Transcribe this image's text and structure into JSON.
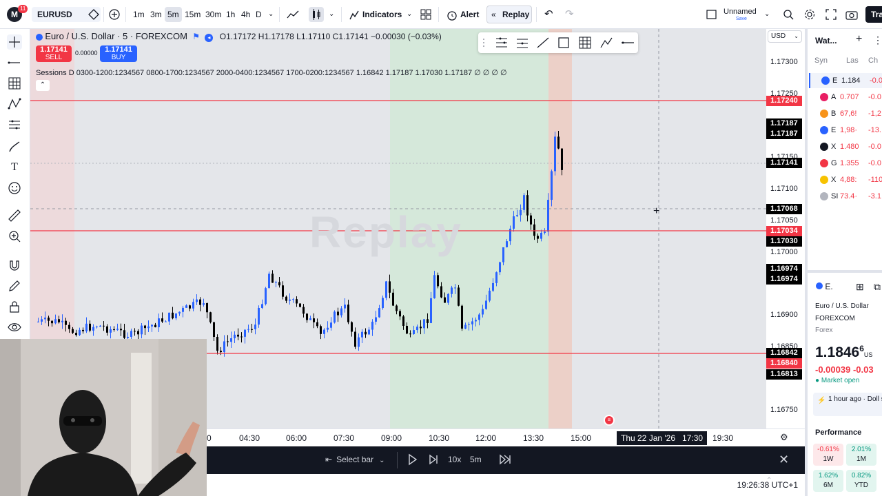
{
  "topbar": {
    "logo_letter": "M",
    "logo_badge": "11",
    "symbol": "EURUSD",
    "intervals": [
      "1m",
      "3m",
      "5m",
      "15m",
      "30m",
      "1h",
      "4h",
      "D"
    ],
    "active_interval": "5m",
    "indicators_label": "Indicators",
    "alert_label": "Alert",
    "replay_label": "Replay",
    "layout_name": "Unnamed",
    "layout_status": "Save",
    "trade_label": "Tra"
  },
  "legend": {
    "title": "Euro / U.S. Dollar · 5 · FOREXCOM",
    "ohlc": "O1.17172 H1.17178 L1.17110 C1.17141 −0.00030 (−0.03%)",
    "sell_price": "1.17141",
    "sell_label": "SELL",
    "buy_price": "1.17141",
    "buy_label": "BUY",
    "spread": "0.00000",
    "sessions": "Sessions D 0300-1200:1234567 0800-1700:1234567 2000-0400:1234567 1700-0200:1234567  1.16842  1.17187  1.17030  1.17187  ∅  ∅  ∅  ∅"
  },
  "watermark": "Replay",
  "currency": "USD",
  "price_ticks": [
    "1.17300",
    "1.17250",
    "1.17150",
    "1.17100",
    "1.17050",
    "1.17000",
    "1.16900",
    "1.16850",
    "1.16750"
  ],
  "price_labels": [
    {
      "text": "1.17240",
      "style": "red"
    },
    {
      "text": "1.17187",
      "style": "black"
    },
    {
      "text": "1.17187",
      "style": "black"
    },
    {
      "text": "1.17141",
      "style": "black"
    },
    {
      "text": "1.17068",
      "style": "black"
    },
    {
      "text": "1.17034",
      "style": "red"
    },
    {
      "text": "1.17030",
      "style": "black"
    },
    {
      "text": "1.16974",
      "style": "black"
    },
    {
      "text": "1.16974",
      "style": "black"
    },
    {
      "text": "1.16842",
      "style": "black"
    },
    {
      "text": "1.16840",
      "style": "red"
    },
    {
      "text": "1.16813",
      "style": "black"
    }
  ],
  "time_ticks": [
    "0",
    "04:30",
    "06:00",
    "07:30",
    "09:00",
    "10:30",
    "12:00",
    "13:30",
    "15:00",
    "19:30"
  ],
  "crosshair_time": "Thu 22 Jan '26   17:30",
  "replay": {
    "select_bar": "Select bar",
    "speed": "10x",
    "interval": "5m"
  },
  "status_time": "19:26:38 UTC+1",
  "watchlist": {
    "title": "Wat...",
    "columns": [
      "Syn",
      "Las",
      "Ch"
    ],
    "rows": [
      {
        "sym": "E",
        "last": "1.184",
        "chg": "-0.0",
        "chg_color": "neg"
      },
      {
        "sym": "A",
        "last": "0.707",
        "chg": "-0.0",
        "chg_color": "neg"
      },
      {
        "sym": "B",
        "last": "67,6!",
        "chg": "-1,2",
        "chg_color": "neg"
      },
      {
        "sym": "E",
        "last": "1,98·",
        "chg": "-13.",
        "chg_color": "neg"
      },
      {
        "sym": "X",
        "last": "1.480",
        "chg": "-0.0",
        "chg_color": "neg"
      },
      {
        "sym": "G",
        "last": "1.355",
        "chg": "-0.0",
        "chg_color": "neg"
      },
      {
        "sym": "X",
        "last": "4,88:",
        "chg": "-110",
        "chg_color": "neg"
      },
      {
        "sym": "SI",
        "last": "73.4·",
        "chg": "-3.1",
        "chg_color": "neg"
      }
    ],
    "detail": {
      "short": "E.",
      "name": "Euro / U.S. Dollar",
      "exchange": "FOREXCOM",
      "type": "Forex",
      "price": "1.1846",
      "price_sup": "6",
      "price_unit": "US",
      "change": "-0.00039",
      "change_pct": "-0.03",
      "market_status": "Market open",
      "news_time": "1 hour ago",
      "news_text": "Doll strengthens as..."
    },
    "performance_label": "Performance",
    "performance": [
      {
        "value": "-0.61%",
        "period": "1W",
        "color": "neg"
      },
      {
        "value": "2.01%",
        "period": "1M",
        "color": "pos"
      },
      {
        "value": "1.62%",
        "period": "6M",
        "color": "pos"
      },
      {
        "value": "0.82%",
        "period": "YTD",
        "color": "pos"
      }
    ]
  },
  "colors": {
    "accent": "#2962ff",
    "sell": "#f23645",
    "buy": "#2962ff",
    "level_line": "#f23645",
    "bull_candle": "#2962ff",
    "bear_candle": "#000000"
  }
}
